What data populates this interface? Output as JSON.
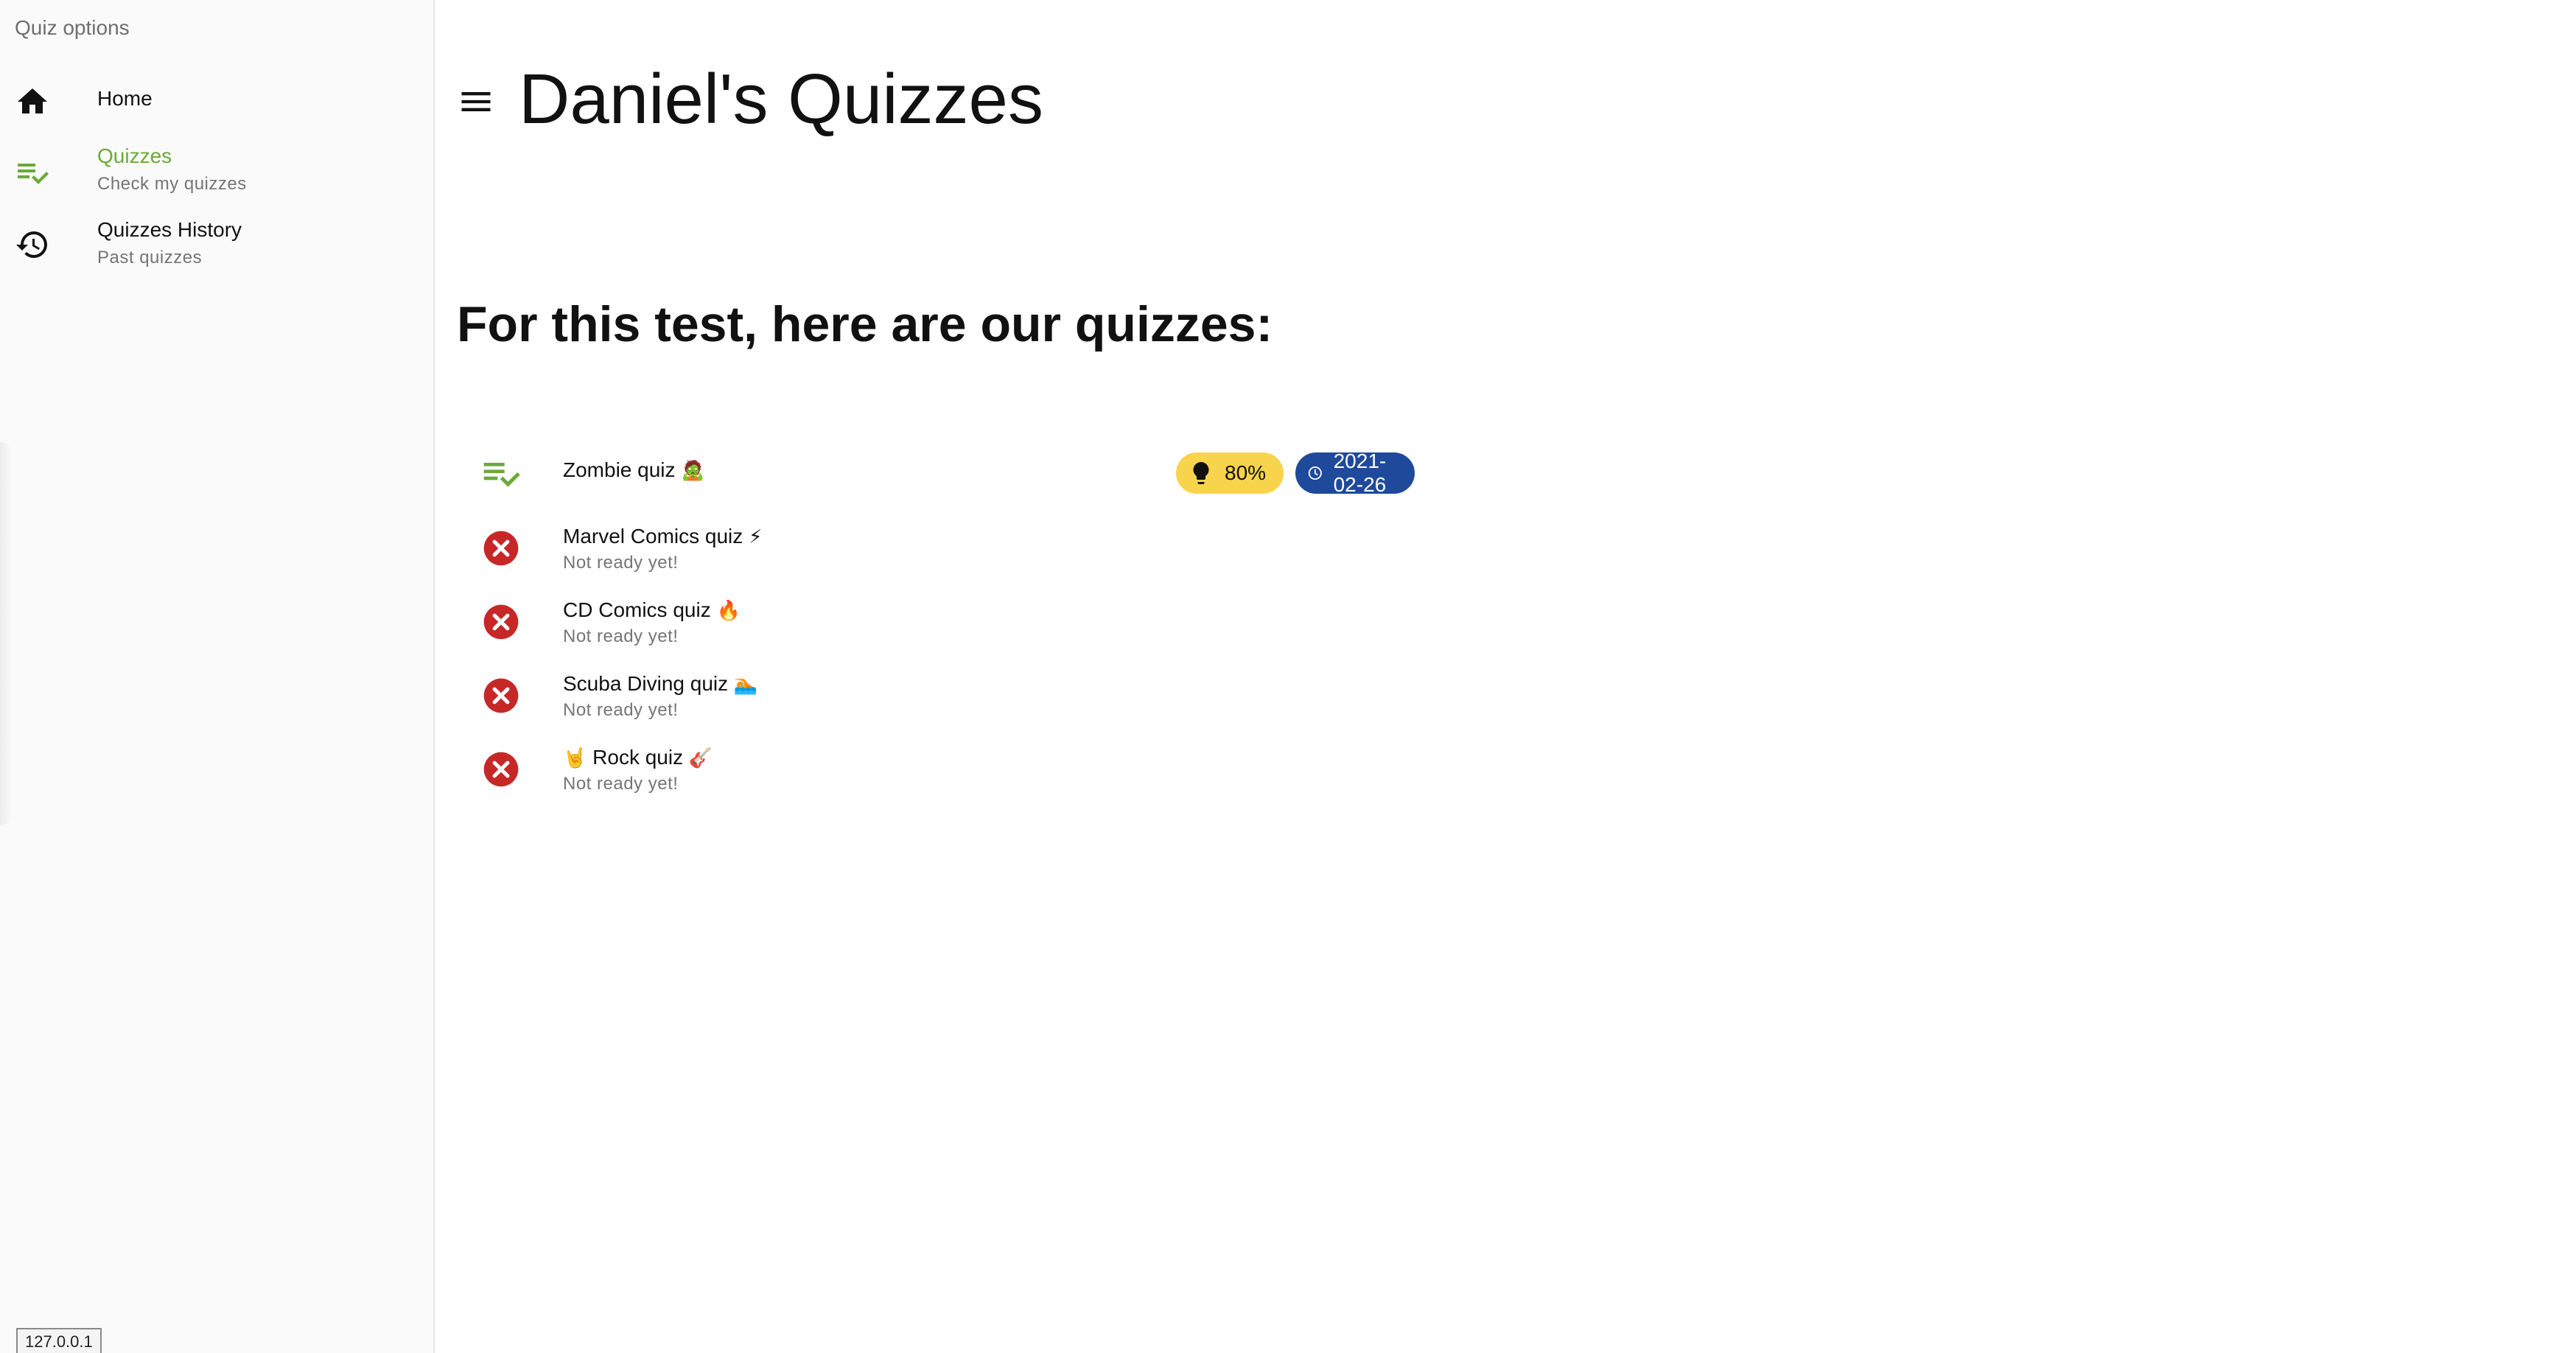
{
  "sidebar": {
    "title": "Quiz options",
    "items": [
      {
        "label": "Home",
        "sub": "",
        "icon": "home-icon",
        "active": false
      },
      {
        "label": "Quizzes",
        "sub": "Check my quizzes",
        "icon": "playlist-check-icon",
        "active": true
      },
      {
        "label": "Quizzes History",
        "sub": "Past quizzes",
        "icon": "history-icon",
        "active": false
      }
    ],
    "ip": "127.0.0.1"
  },
  "header": {
    "menu_icon": "menu-icon",
    "title": "Daniel's Quizzes"
  },
  "main": {
    "heading": "For this test, here are our quizzes:",
    "quizzes": [
      {
        "title": "Zombie quiz",
        "emoji": "🧟",
        "status_icon": "playlist-check-icon",
        "score": "80%",
        "date": "2021-02-26",
        "sub": ""
      },
      {
        "title": "Marvel Comics quiz",
        "emoji": "⚡",
        "status_icon": "cancel-icon",
        "sub": "Not ready yet!"
      },
      {
        "title": "CD Comics quiz",
        "emoji": "🔥",
        "status_icon": "cancel-icon",
        "sub": "Not ready yet!"
      },
      {
        "title": "Scuba Diving quiz",
        "emoji": "🏊",
        "status_icon": "cancel-icon",
        "sub": "Not ready yet!"
      },
      {
        "title_prefix_emoji": "🤘",
        "title": "Rock quiz",
        "emoji": "🎸",
        "status_icon": "cancel-icon",
        "sub": "Not ready yet!"
      }
    ]
  },
  "colors": {
    "accent_green": "#6aaa3a",
    "error_red": "#c62828",
    "score_chip": "#f8d34c",
    "date_chip": "#1f4a9c"
  }
}
